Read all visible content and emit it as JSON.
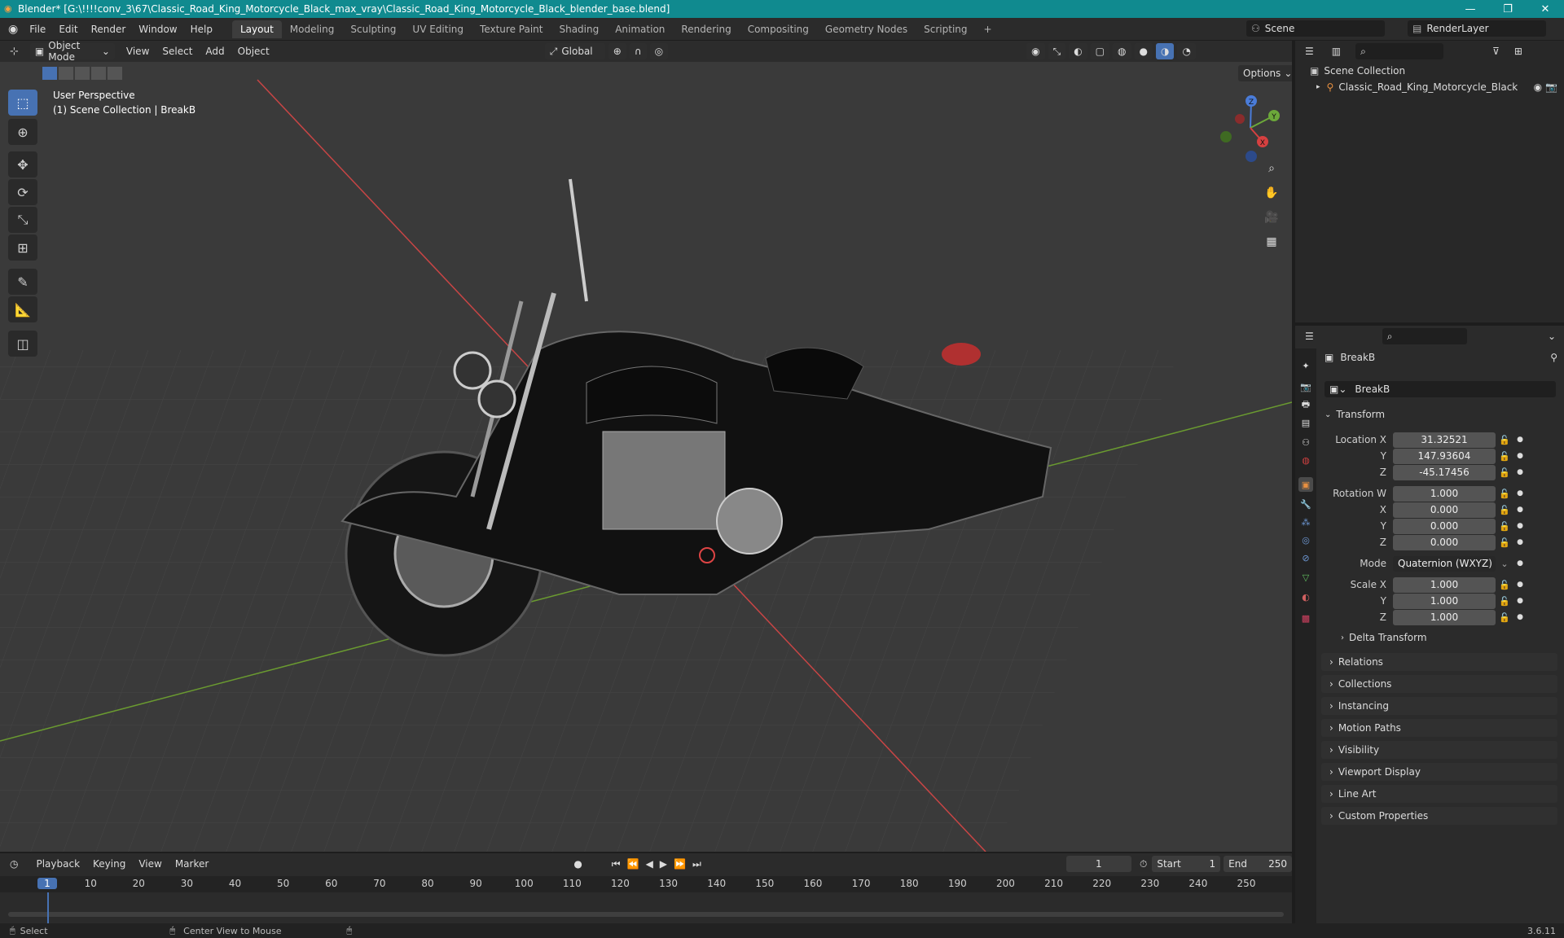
{
  "window": {
    "title": "Blender* [G:\\!!!!conv_3\\67\\Classic_Road_King_Motorcycle_Black_max_vray\\Classic_Road_King_Motorcycle_Black_blender_base.blend]",
    "title_color": "#108a8f"
  },
  "menu": {
    "items": [
      "File",
      "Edit",
      "Render",
      "Window",
      "Help"
    ],
    "workspaces": [
      "Layout",
      "Modeling",
      "Sculpting",
      "UV Editing",
      "Texture Paint",
      "Shading",
      "Animation",
      "Rendering",
      "Compositing",
      "Geometry Nodes",
      "Scripting"
    ],
    "active_workspace": "Layout",
    "scene": "Scene",
    "view_layer": "RenderLayer"
  },
  "viewport": {
    "mode": "Object Mode",
    "menus": [
      "View",
      "Select",
      "Add",
      "Object"
    ],
    "orientation": "Global",
    "options_label": "Options",
    "overlay_line1": "User Perspective",
    "overlay_line2": "(1) Scene Collection | BreakB",
    "gizmo": {
      "z": "Z",
      "y": "Y",
      "x": "X"
    },
    "background": "#3a3a3a",
    "x_axis_color": "#c84545",
    "y_axis_color": "#6a9a30"
  },
  "outliner": {
    "root": "Scene Collection",
    "items": [
      {
        "label": "Classic_Road_King_Motorcycle_Black"
      }
    ]
  },
  "properties": {
    "object_name": "BreakB",
    "data_name": "BreakB",
    "transform_label": "Transform",
    "location": {
      "label": "Location X",
      "x": "31.32521",
      "y": "147.93604",
      "z": "-45.17456"
    },
    "rotation": {
      "label": "Rotation W",
      "w": "1.000",
      "x": "0.000",
      "y": "0.000",
      "z": "0.000"
    },
    "mode_label": "Mode",
    "mode_value": "Quaternion (WXYZ)",
    "scale": {
      "label": "Scale X",
      "x": "1.000",
      "y": "1.000",
      "z": "1.000"
    },
    "axis_labels": {
      "y": "Y",
      "z": "Z",
      "x": "X"
    },
    "delta": "Delta Transform",
    "panels": [
      "Relations",
      "Collections",
      "Instancing",
      "Motion Paths",
      "Visibility",
      "Viewport Display",
      "Line Art",
      "Custom Properties"
    ]
  },
  "timeline": {
    "menus": [
      "Playback",
      "Keying",
      "View",
      "Marker"
    ],
    "current_frame": "1",
    "start_label": "Start",
    "start": "1",
    "end_label": "End",
    "end": "250",
    "ticks": [
      "1",
      "10",
      "20",
      "30",
      "40",
      "50",
      "60",
      "70",
      "80",
      "90",
      "100",
      "110",
      "120",
      "130",
      "140",
      "150",
      "160",
      "170",
      "180",
      "190",
      "200",
      "210",
      "220",
      "230",
      "240",
      "250"
    ]
  },
  "statusbar": {
    "select": "Select",
    "center": "Center View to Mouse",
    "version": "3.6.11"
  },
  "icons": [
    "blender-logo-icon",
    "select-box-icon",
    "cursor-icon",
    "move-icon",
    "rotate-icon",
    "scale-icon",
    "transform-icon",
    "annotate-icon",
    "measure-icon",
    "add-cube-icon",
    "zoom-icon",
    "pan-icon",
    "camera-icon",
    "grid-icon",
    "eye-icon",
    "camera-render-icon",
    "filter-icon",
    "search-icon",
    "pin-icon",
    "lock-icon"
  ]
}
